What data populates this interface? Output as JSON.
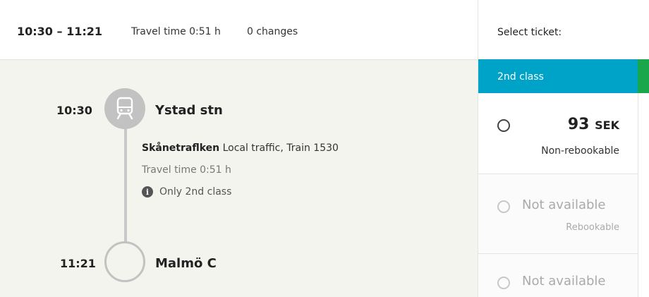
{
  "journey": {
    "time_range": "10:30 – 11:21",
    "travel_time": "Travel time 0:51 h",
    "changes": "0 changes"
  },
  "departure": {
    "time": "10:30",
    "station": "Ystad stn",
    "icon": "train-icon"
  },
  "segment": {
    "operator": "Skånetraflken",
    "description": " Local traffic, Train 1530",
    "travel_time": "Travel time 0:51 h",
    "class_note": "Only 2nd class"
  },
  "arrival": {
    "time": "11:21",
    "station": "Malmö C"
  },
  "tickets": {
    "label": "Select ticket:",
    "class_tab": "2nd class",
    "options": [
      {
        "price": "93",
        "currency": "SEK",
        "condition": "Non-rebookable",
        "available": true
      },
      {
        "status": "Not available",
        "condition": "Rebookable",
        "available": false
      },
      {
        "status": "Not available",
        "available": false
      }
    ]
  },
  "colors": {
    "class_tab": "#00a3c8",
    "class_tab_adjacent": "#1aa64a",
    "detail_background": "#f4f4ef",
    "route_line": "#c2c2c2"
  }
}
